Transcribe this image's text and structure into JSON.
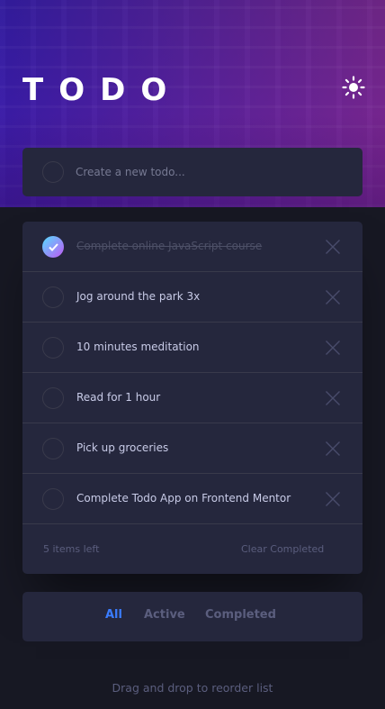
{
  "header": {
    "title": "TODO"
  },
  "create": {
    "placeholder": "Create a new todo..."
  },
  "todos": [
    {
      "text": "Complete online JavaScript course",
      "completed": true
    },
    {
      "text": "Jog around the park 3x",
      "completed": false
    },
    {
      "text": "10 minutes meditation",
      "completed": false
    },
    {
      "text": "Read for 1 hour",
      "completed": false
    },
    {
      "text": "Pick up groceries",
      "completed": false
    },
    {
      "text": "Complete Todo App on Frontend Mentor",
      "completed": false
    }
  ],
  "footer": {
    "items_left": "5 items left",
    "clear_label": "Clear Completed"
  },
  "filters": {
    "all": "All",
    "active": "Active",
    "completed": "Completed",
    "selected": "All"
  },
  "hint": "Drag and drop to reorder list",
  "colors": {
    "background": "#171823",
    "card": "#25273D",
    "accent": "#3A7CFD",
    "check_gradient_start": "#55DDFF",
    "check_gradient_end": "#C058F3"
  }
}
